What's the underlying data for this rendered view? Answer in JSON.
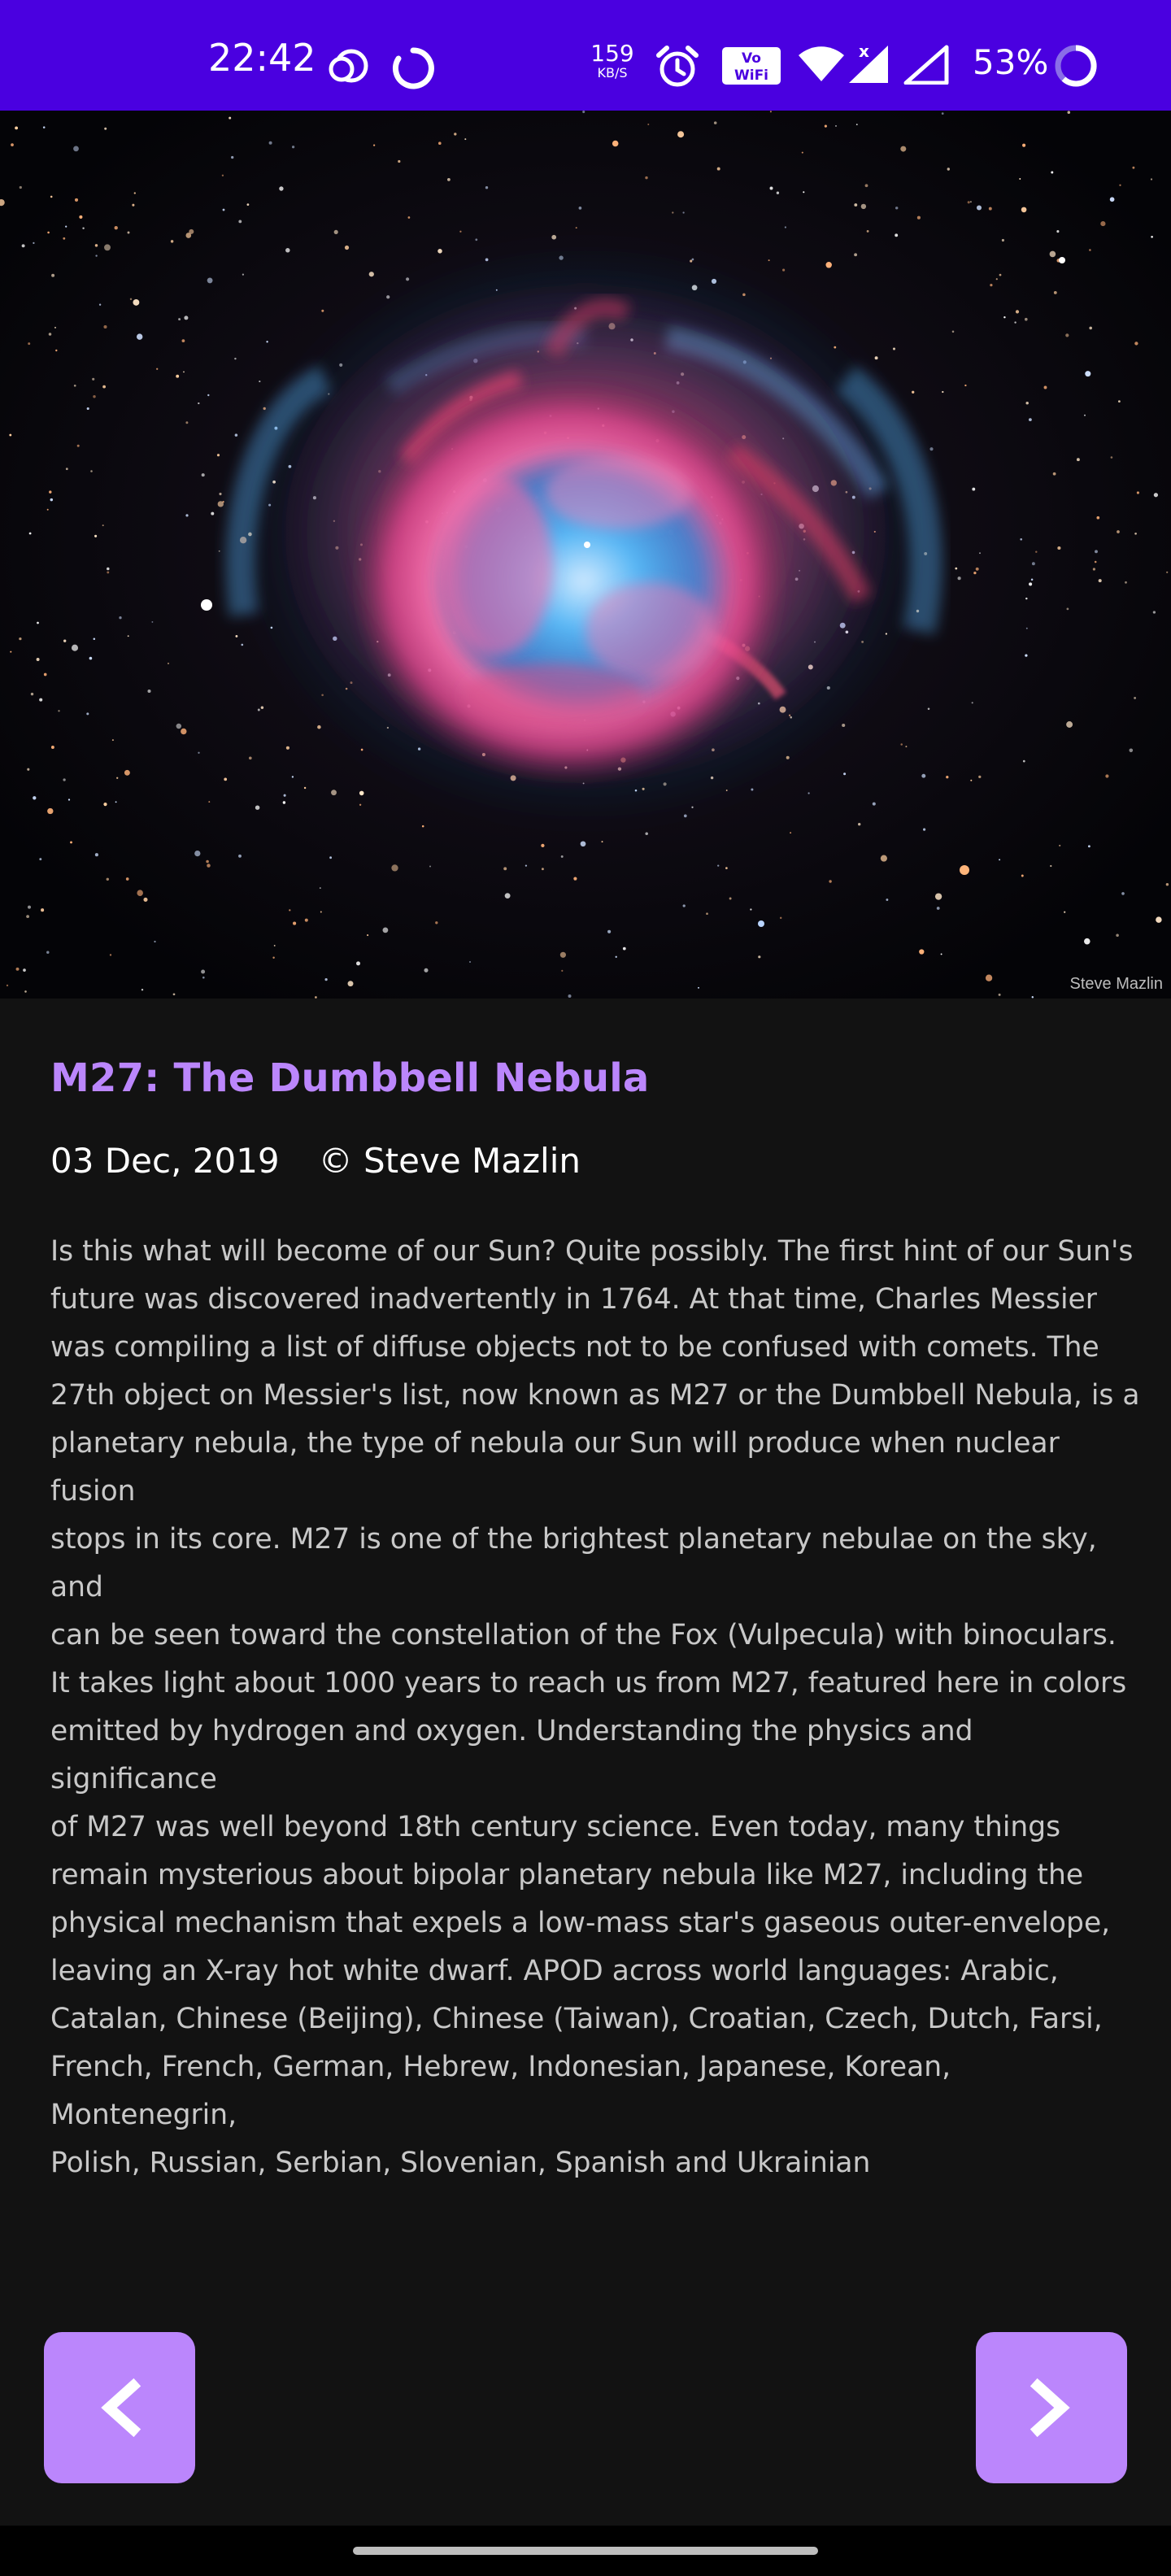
{
  "status_bar": {
    "time": "22:42",
    "speed_value": "159",
    "speed_unit": "KB/S",
    "battery": "53%",
    "icons": [
      "cloud-icon",
      "sync-circle-icon",
      "alarm-icon",
      "vowifi-icon",
      "wifi-icon",
      "signal-x-icon",
      "signal-icon",
      "battery-ring-icon"
    ],
    "background": "#4a00e0"
  },
  "hero": {
    "credit": "Steve Mazlin"
  },
  "article": {
    "title": "M27: The Dumbbell Nebula",
    "date": "03 Dec, 2019",
    "copyright": "© Steve Mazlin",
    "description": "Is this what will become of our Sun? Quite possibly.  The first hint of our Sun's\nfuture was discovered inadvertently in 1764. At that time, Charles Messier\nwas compiling a list of diffuse objects not to be confused with comets. The\n27th object on Messier's list, now known as M27 or the Dumbbell Nebula, is a\nplanetary nebula, the type of nebula our Sun will produce when nuclear fusion\nstops in its core. M27 is one of the brightest planetary nebulae on the sky, and\ncan be seen toward the constellation of the Fox (Vulpecula) with binoculars.\nIt takes light about 1000 years to reach us from M27, featured here in colors\nemitted by hydrogen and oxygen. Understanding the physics and significance\nof M27 was well beyond 18th century science. Even today, many things\nremain mysterious about bipolar planetary nebula like M27, including the\nphysical mechanism that expels a low-mass star's gaseous outer-envelope,\nleaving an X-ray hot white dwarf.   APOD across world languages: Arabic,\nCatalan, Chinese (Beijing), Chinese (Taiwan), Croatian, Czech, Dutch, Farsi,\nFrench, French, German, Hebrew, Indonesian, Japanese, Korean, Montenegrin,\nPolish, Russian, Serbian, Slovenian,  Spanish and Ukrainian"
  },
  "navigation": {
    "prev_icon": "chevron-left-icon",
    "next_icon": "chevron-right-icon",
    "button_color": "#bb86fc"
  },
  "colors": {
    "background": "#121212",
    "accent": "#bb86fc",
    "title": "#bb86fc",
    "text": "#c8c8c8"
  }
}
